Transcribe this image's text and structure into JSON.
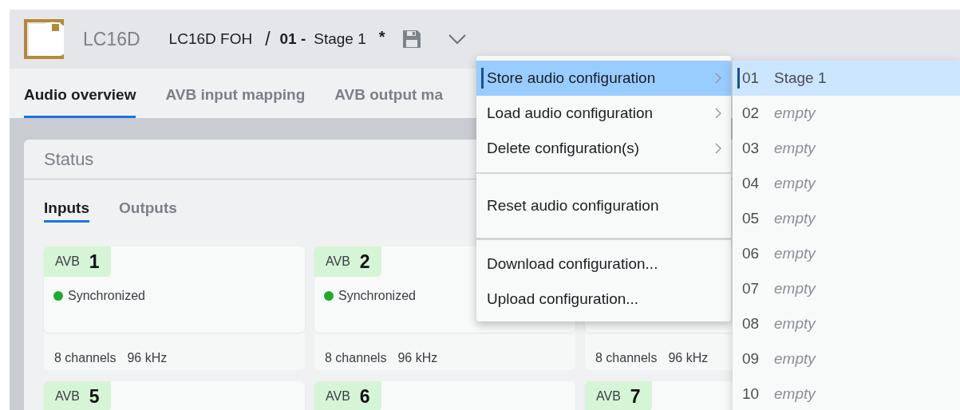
{
  "header": {
    "device_model": "LC16D",
    "device_name": "LC16D FOH",
    "separator": "/",
    "config_number": "01 -",
    "config_name": "Stage 1",
    "modified_mark": "*"
  },
  "tabs": [
    {
      "label": "Audio overview",
      "selected": true
    },
    {
      "label": "AVB input mapping",
      "selected": false
    },
    {
      "label": "AVB output ma",
      "selected": false
    }
  ],
  "status_panel": {
    "title": "Status",
    "subtabs": [
      {
        "label": "Inputs",
        "selected": true
      },
      {
        "label": "Outputs",
        "selected": false
      }
    ],
    "streams": [
      {
        "label": "AVB",
        "number": "1",
        "status": "Synchronized",
        "color": "#22a82a",
        "channels": "8 channels",
        "rate": "96 kHz"
      },
      {
        "label": "AVB",
        "number": "2",
        "status": "Synchronized",
        "color": "#22a82a",
        "channels": "8 channels",
        "rate": "96 kHz"
      },
      {
        "channels": "8 channels",
        "rate": "96 kHz"
      },
      {
        "label": "AVB",
        "number": "5"
      },
      {
        "label": "AVB",
        "number": "6"
      },
      {
        "label": "AVB",
        "number": "7"
      }
    ]
  },
  "config_menu": {
    "groups": [
      [
        {
          "label": "Store audio configuration",
          "kind": "submenu",
          "selected": true
        },
        {
          "label": "Load audio configuration",
          "kind": "submenu",
          "selected": false
        },
        {
          "label": "Delete configuration(s)",
          "kind": "submenu",
          "selected": false
        }
      ],
      [
        {
          "label": "Reset audio configuration",
          "kind": "action",
          "selected": false
        }
      ],
      [
        {
          "label": "Download configuration...",
          "kind": "action",
          "selected": false
        },
        {
          "label": "Upload configuration...",
          "kind": "action",
          "selected": false
        }
      ]
    ]
  },
  "slot_submenu": [
    {
      "number": "01",
      "name": "Stage 1",
      "kind": "stored",
      "selected": true
    },
    {
      "number": "02",
      "name": "empty",
      "kind": "empty",
      "selected": false
    },
    {
      "number": "03",
      "name": "empty",
      "kind": "empty",
      "selected": false
    },
    {
      "number": "04",
      "name": "empty",
      "kind": "empty",
      "selected": false
    },
    {
      "number": "05",
      "name": "empty",
      "kind": "empty",
      "selected": false
    },
    {
      "number": "06",
      "name": "empty",
      "kind": "empty",
      "selected": false
    },
    {
      "number": "07",
      "name": "empty",
      "kind": "empty",
      "selected": false
    },
    {
      "number": "08",
      "name": "empty",
      "kind": "empty",
      "selected": false
    },
    {
      "number": "09",
      "name": "empty",
      "kind": "empty",
      "selected": false
    },
    {
      "number": "10",
      "name": "empty",
      "kind": "empty",
      "selected": false
    }
  ]
}
